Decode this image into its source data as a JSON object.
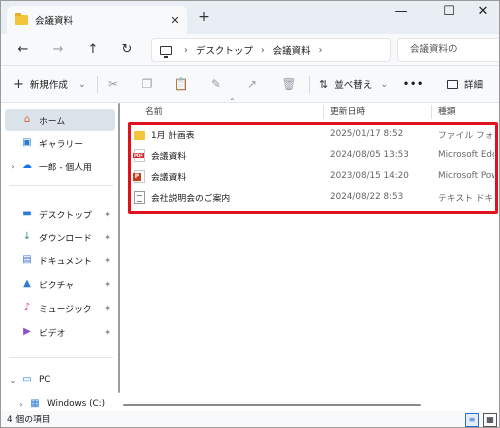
{
  "window": {
    "tab_title": "会議資料",
    "tab_close": "✕",
    "new_tab": "+",
    "minimize": "—",
    "maximize": "☐",
    "close": "✕"
  },
  "nav": {
    "back": "←",
    "forward": "→",
    "up": "↑",
    "refresh": "↻",
    "breadcrumb": [
      "デスクトップ",
      "会議資料"
    ],
    "separator": "›",
    "search_placeholder": "会議資料の"
  },
  "toolbar": {
    "new_label": "新規作成",
    "new_icon": "+",
    "dropdown": "⌄",
    "sort_label": "並べ替え",
    "more": "•••",
    "details_label": "詳細"
  },
  "sidebar": {
    "items": [
      {
        "label": "ホーム",
        "icon": "⌂",
        "color": "#d4652f"
      },
      {
        "label": "ギャラリー",
        "icon": "▣",
        "color": "#2b7bd4"
      },
      {
        "label": "一郎 - 個人用",
        "icon": "☁",
        "color": "#1a73e8"
      },
      {
        "label": "デスクトップ",
        "icon": "▬",
        "color": "#2b7bd4"
      },
      {
        "label": "ダウンロード",
        "icon": "↓",
        "color": "#2b9a6a"
      },
      {
        "label": "ドキュメント",
        "icon": "▤",
        "color": "#3b6fd0"
      },
      {
        "label": "ピクチャ",
        "icon": "▲",
        "color": "#2b7bd4"
      },
      {
        "label": "ミュージック",
        "icon": "♪",
        "color": "#d4409a"
      },
      {
        "label": "ビデオ",
        "icon": "▶",
        "color": "#8a4fd0"
      },
      {
        "label": "PC",
        "icon": "▭",
        "color": "#2b7bd4"
      },
      {
        "label": "Windows (C:)",
        "icon": "▦",
        "color": "#2b7bd4"
      }
    ],
    "pin_icon": "📌",
    "chevron_right": "›",
    "chevron_down": "⌄"
  },
  "columns": {
    "name": "名前",
    "date": "更新日時",
    "type": "種類"
  },
  "files": [
    {
      "name": "1月 計画表",
      "date": "2025/01/17 8:52",
      "type": "ファイル フォルダー",
      "icon": "folder"
    },
    {
      "name": "会議資料",
      "date": "2024/08/05 13:53",
      "type": "Microsoft Edge",
      "icon": "pdf"
    },
    {
      "name": "会議資料",
      "date": "2023/08/15 14:20",
      "type": "Microsoft Power",
      "icon": "ppt"
    },
    {
      "name": "会社説明会のご案内",
      "date": "2024/08/22 8:53",
      "type": "テキスト ドキュメント",
      "icon": "txt"
    }
  ],
  "status": {
    "count": "4 個の項目"
  },
  "colors": {
    "highlight": "#e0101c",
    "folder": "#f3c53a"
  }
}
